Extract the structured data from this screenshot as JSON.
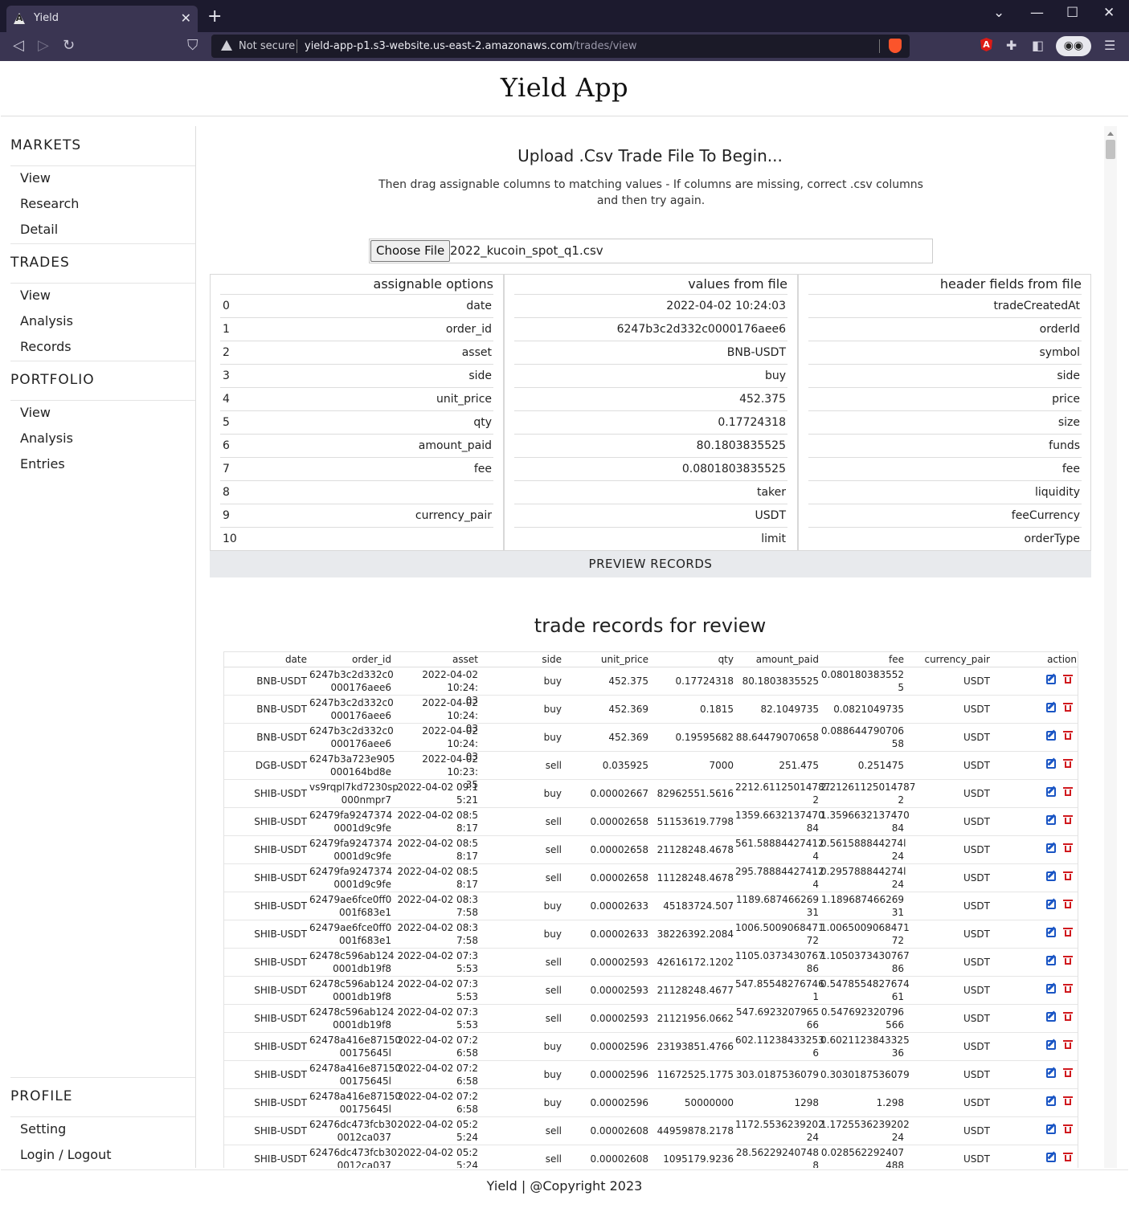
{
  "browser": {
    "tab_title": "Yield",
    "new_tab": "+",
    "tab_close": "✕",
    "not_secure": "Not secure",
    "host": "yield-app-p1.s3-website.us-east-2.amazonaws.com",
    "path": "/trades/view",
    "angular_glyph": "A",
    "profile_glyph": "◉◉"
  },
  "app": {
    "title": "Yield App",
    "footer": "Yield | @Copyright 2023"
  },
  "sidebar": {
    "markets": {
      "title": "MARKETS",
      "items": [
        "View",
        "Research",
        "Detail"
      ]
    },
    "trades": {
      "title": "TRADES",
      "items": [
        "View",
        "Analysis",
        "Records"
      ]
    },
    "portfolio": {
      "title": "PORTFOLIO",
      "items": [
        "View",
        "Analysis",
        "Entries"
      ]
    },
    "profile": {
      "title": "PROFILE",
      "items": [
        "Setting",
        "Login / Logout"
      ]
    }
  },
  "upload": {
    "title": "Upload .Csv Trade File To Begin...",
    "subtitle": "Then drag assignable columns to matching values - If columns are missing, correct .csv columns and then try again.",
    "button": "Choose File",
    "file_name": "2022_kucoin_spot_q1.csv"
  },
  "mapping": {
    "assignable_header": "assignable options",
    "values_header": "values from file",
    "fields_header": "header fields from file",
    "assignable": [
      {
        "idx": "0",
        "name": "date"
      },
      {
        "idx": "1",
        "name": "order_id"
      },
      {
        "idx": "2",
        "name": "asset"
      },
      {
        "idx": "3",
        "name": "side"
      },
      {
        "idx": "4",
        "name": "unit_price"
      },
      {
        "idx": "5",
        "name": "qty"
      },
      {
        "idx": "6",
        "name": "amount_paid"
      },
      {
        "idx": "7",
        "name": "fee"
      },
      {
        "idx": "8",
        "name": ""
      },
      {
        "idx": "9",
        "name": "currency_pair"
      },
      {
        "idx": "10",
        "name": ""
      }
    ],
    "values": [
      "2022-04-02 10:24:03",
      "6247b3c2d332c0000176aee6",
      "BNB-USDT",
      "buy",
      "452.375",
      "0.17724318",
      "80.1803835525",
      "0.0801803835525",
      "taker",
      "USDT",
      "limit"
    ],
    "fields": [
      "tradeCreatedAt",
      "orderId",
      "symbol",
      "side",
      "price",
      "size",
      "funds",
      "fee",
      "liquidity",
      "feeCurrency",
      "orderType"
    ],
    "preview_button": "PREVIEW RECORDS"
  },
  "records": {
    "title": "trade records for review",
    "columns": {
      "date": "date",
      "order_id": "order_id",
      "asset": "asset",
      "side": "side",
      "unit_price": "unit_price",
      "qty": "qty",
      "amount_paid": "amount_paid",
      "fee": "fee",
      "currency_pair": "currency_pair",
      "action": "action"
    },
    "rows": [
      {
        "date": "BNB-USDT",
        "order": [
          "6247b3c2d332c0",
          "000176aee6"
        ],
        "asset": [
          "2022-04-02 10:24:",
          "03"
        ],
        "side": "buy",
        "price": "452.375",
        "qty": "0.17724318",
        "amt": [
          "80.1803835525"
        ],
        "fee": [
          "0.080180383552",
          "5"
        ],
        "pair": "USDT"
      },
      {
        "date": "BNB-USDT",
        "order": [
          "6247b3c2d332c0",
          "000176aee6"
        ],
        "asset": [
          "2022-04-02 10:24:",
          "03"
        ],
        "side": "buy",
        "price": "452.369",
        "qty": "0.1815",
        "amt": [
          "82.1049735"
        ],
        "fee": [
          "0.0821049735"
        ],
        "pair": "USDT"
      },
      {
        "date": "BNB-USDT",
        "order": [
          "6247b3c2d332c0",
          "000176aee6"
        ],
        "asset": [
          "2022-04-02 10:24:",
          "03"
        ],
        "side": "buy",
        "price": "452.369",
        "qty": "0.19595682",
        "amt": [
          "88.64479070658"
        ],
        "fee": [
          "0.088644790706",
          "58"
        ],
        "pair": "USDT"
      },
      {
        "date": "DGB-USDT",
        "order": [
          "6247b3a723e905",
          "000164bd8e"
        ],
        "asset": [
          "2022-04-02 10:23:",
          "35"
        ],
        "side": "sell",
        "price": "0.035925",
        "qty": "7000",
        "amt": [
          "251.475"
        ],
        "fee": [
          "0.251475"
        ],
        "pair": "USDT"
      },
      {
        "date": "SHIB-USDT",
        "order": [
          "vs9rqpl7kd7230sp",
          "000nmpr7"
        ],
        "asset": [
          "2022-04-02 09:1",
          "5:21"
        ],
        "side": "buy",
        "price": "0.00002667",
        "qty": "82962551.5616",
        "amt": [
          "2212.61125014787",
          "2"
        ],
        "fee": [
          "2.21261125014787",
          "2"
        ],
        "pair": "USDT"
      },
      {
        "date": "SHIB-USDT",
        "order": [
          "62479fa9247374",
          "0001d9c9fe"
        ],
        "asset": [
          "2022-04-02 08:5",
          "8:17"
        ],
        "side": "sell",
        "price": "0.00002658",
        "qty": "51153619.7798",
        "amt": [
          "1359.6632137470",
          "84"
        ],
        "fee": [
          "1.3596632137470",
          "84"
        ],
        "pair": "USDT"
      },
      {
        "date": "SHIB-USDT",
        "order": [
          "62479fa9247374",
          "0001d9c9fe"
        ],
        "asset": [
          "2022-04-02 08:5",
          "8:17"
        ],
        "side": "sell",
        "price": "0.00002658",
        "qty": "21128248.4678",
        "amt": [
          "561.58884427412",
          "4"
        ],
        "fee": [
          "0.561588844274l",
          "24"
        ],
        "pair": "USDT"
      },
      {
        "date": "SHIB-USDT",
        "order": [
          "62479fa9247374",
          "0001d9c9fe"
        ],
        "asset": [
          "2022-04-02 08:5",
          "8:17"
        ],
        "side": "sell",
        "price": "0.00002658",
        "qty": "11128248.4678",
        "amt": [
          "295.78884427412",
          "4"
        ],
        "fee": [
          "0.295788844274l",
          "24"
        ],
        "pair": "USDT"
      },
      {
        "date": "SHIB-USDT",
        "order": [
          "62479ae6fce0ff0",
          "001f683e1"
        ],
        "asset": [
          "2022-04-02 08:3",
          "7:58"
        ],
        "side": "buy",
        "price": "0.00002633",
        "qty": "45183724.507",
        "amt": [
          "1189.687466269",
          "31"
        ],
        "fee": [
          "1.189687466269",
          "31"
        ],
        "pair": "USDT"
      },
      {
        "date": "SHIB-USDT",
        "order": [
          "62479ae6fce0ff0",
          "001f683e1"
        ],
        "asset": [
          "2022-04-02 08:3",
          "7:58"
        ],
        "side": "buy",
        "price": "0.00002633",
        "qty": "38226392.2084",
        "amt": [
          "1006.5009068471",
          "72"
        ],
        "fee": [
          "1.0065009068471",
          "72"
        ],
        "pair": "USDT"
      },
      {
        "date": "SHIB-USDT",
        "order": [
          "62478c596ab124",
          "0001db19f8"
        ],
        "asset": [
          "2022-04-02 07:3",
          "5:53"
        ],
        "side": "sell",
        "price": "0.00002593",
        "qty": "42616172.1202",
        "amt": [
          "1105.0373430767",
          "86"
        ],
        "fee": [
          "1.1050373430767",
          "86"
        ],
        "pair": "USDT"
      },
      {
        "date": "SHIB-USDT",
        "order": [
          "62478c596ab124",
          "0001db19f8"
        ],
        "asset": [
          "2022-04-02 07:3",
          "5:53"
        ],
        "side": "sell",
        "price": "0.00002593",
        "qty": "21128248.4677",
        "amt": [
          "547.85548276746",
          "1"
        ],
        "fee": [
          "0.5478554827674",
          "61"
        ],
        "pair": "USDT"
      },
      {
        "date": "SHIB-USDT",
        "order": [
          "62478c596ab124",
          "0001db19f8"
        ],
        "asset": [
          "2022-04-02 07:3",
          "5:53"
        ],
        "side": "sell",
        "price": "0.00002593",
        "qty": "21121956.0662",
        "amt": [
          "547.6923207965",
          "66"
        ],
        "fee": [
          "0.547692320796",
          "566"
        ],
        "pair": "USDT"
      },
      {
        "date": "SHIB-USDT",
        "order": [
          "62478a416e87150",
          "00175645l"
        ],
        "asset": [
          "2022-04-02 07:2",
          "6:58"
        ],
        "side": "buy",
        "price": "0.00002596",
        "qty": "23193851.4766",
        "amt": [
          "602.11238433253",
          "6"
        ],
        "fee": [
          "0.6021123843325",
          "36"
        ],
        "pair": "USDT"
      },
      {
        "date": "SHIB-USDT",
        "order": [
          "62478a416e87150",
          "00175645l"
        ],
        "asset": [
          "2022-04-02 07:2",
          "6:58"
        ],
        "side": "buy",
        "price": "0.00002596",
        "qty": "11672525.1775",
        "amt": [
          "303.0187536079"
        ],
        "fee": [
          "0.3030187536079"
        ],
        "pair": "USDT"
      },
      {
        "date": "SHIB-USDT",
        "order": [
          "62478a416e87150",
          "00175645l"
        ],
        "asset": [
          "2022-04-02 07:2",
          "6:58"
        ],
        "side": "buy",
        "price": "0.00002596",
        "qty": "50000000",
        "amt": [
          "1298"
        ],
        "fee": [
          "1.298"
        ],
        "pair": "USDT"
      },
      {
        "date": "SHIB-USDT",
        "order": [
          "62476dc473fcb30",
          "0012ca037"
        ],
        "asset": [
          "2022-04-02 05:2",
          "5:24"
        ],
        "side": "sell",
        "price": "0.00002608",
        "qty": "44959878.2178",
        "amt": [
          "1172.5536239202",
          "24"
        ],
        "fee": [
          "1.1725536239202",
          "24"
        ],
        "pair": "USDT"
      },
      {
        "date": "SHIB-USDT",
        "order": [
          "62476dc473fcb30",
          "0012ca037"
        ],
        "asset": [
          "2022-04-02 05:2",
          "5:24"
        ],
        "side": "sell",
        "price": "0.00002608",
        "qty": "1095179.9236",
        "amt": [
          "28.56229240748",
          "8"
        ],
        "fee": [
          "0.028562292407",
          "488"
        ],
        "pair": "USDT"
      }
    ]
  }
}
